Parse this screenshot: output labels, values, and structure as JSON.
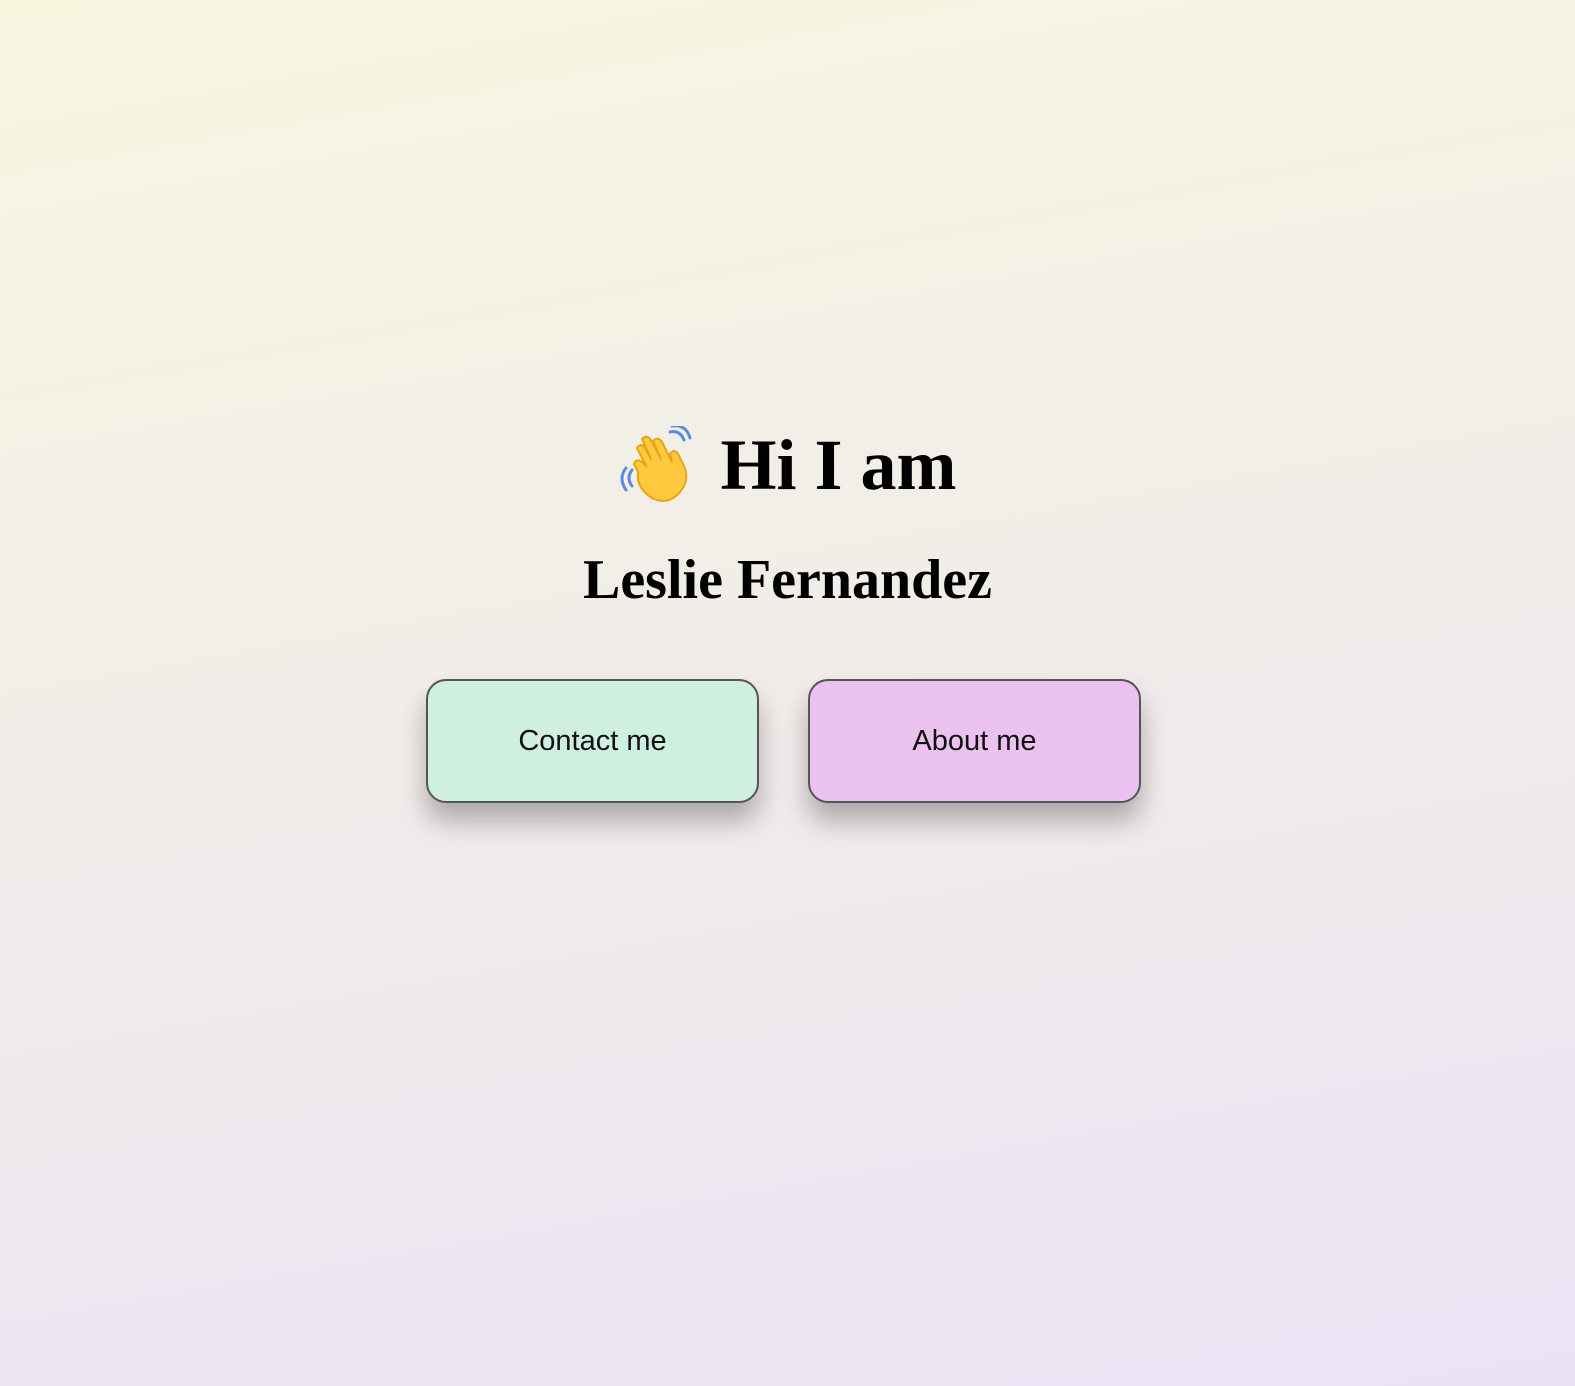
{
  "hero": {
    "greeting_icon": "waving-hand-icon",
    "greeting": "Hi I am",
    "name": "Leslie Fernandez"
  },
  "buttons": {
    "contact_label": "Contact me",
    "contact_color": "#cfefe1",
    "about_label": "About me",
    "about_color": "#ebc1f0"
  },
  "colors": {
    "background_top": "#f8f6df",
    "background_bottom": "#ebe3f5",
    "button_border": "#555555"
  }
}
